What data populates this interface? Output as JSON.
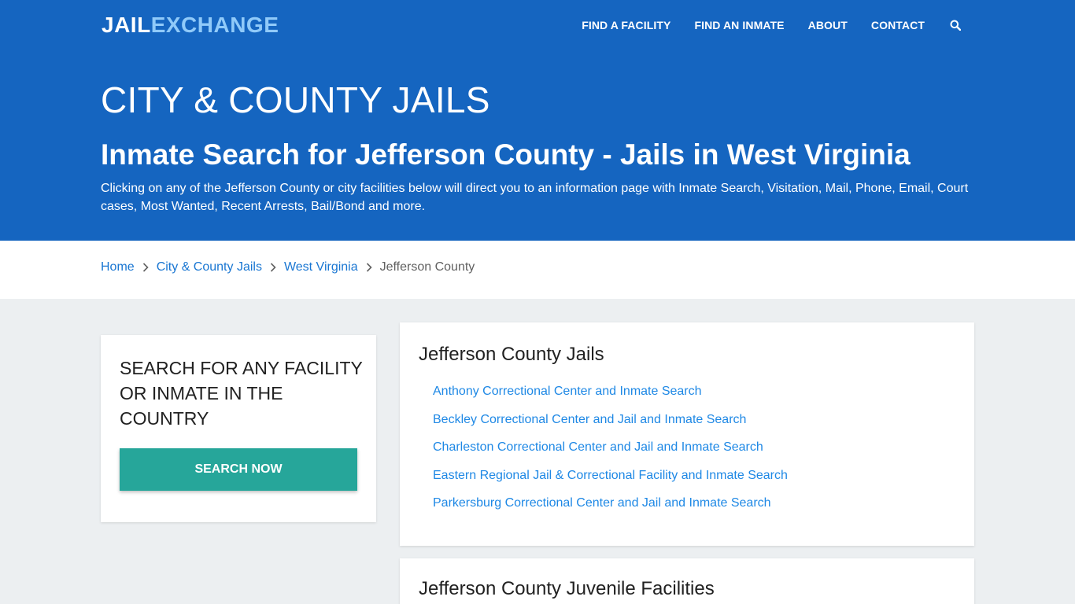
{
  "header": {
    "logo_part1": "JAIL",
    "logo_part2": "EXCHANGE",
    "nav": [
      "FIND A FACILITY",
      "FIND AN INMATE",
      "ABOUT",
      "CONTACT"
    ],
    "search_icon": "search-icon"
  },
  "hero": {
    "title": "CITY & COUNTY JAILS",
    "subtitle": "Inmate Search for Jefferson County - Jails in West Virginia",
    "description": "Clicking on any of the Jefferson County or city facilities below will direct you to an information page with Inmate Search, Visitation, Mail, Phone, Email, Court cases, Most Wanted, Recent Arrests, Bail/Bond and more."
  },
  "breadcrumb": {
    "items": [
      "Home",
      "City & County Jails",
      "West Virginia"
    ],
    "current": "Jefferson County"
  },
  "search_card": {
    "heading": "SEARCH FOR ANY FACILITY OR INMATE IN THE COUNTRY",
    "button": "SEARCH NOW"
  },
  "jails_card": {
    "heading": "Jefferson County Jails",
    "links": [
      "Anthony Correctional Center and Inmate Search",
      "Beckley Correctional Center and Jail and Inmate Search",
      "Charleston Correctional Center and Jail and Inmate Search",
      "Eastern Regional Jail & Correctional Facility and Inmate Search",
      "Parkersburg Correctional Center and Jail and Inmate Search"
    ]
  },
  "juvenile_card": {
    "heading": "Jefferson County Juvenile Facilities"
  },
  "colors": {
    "primary_blue": "#1565c0",
    "logo_accent": "#90caf9",
    "button_teal": "#26a69a",
    "link_blue": "#1e88e5",
    "page_bg": "#eceff1"
  }
}
